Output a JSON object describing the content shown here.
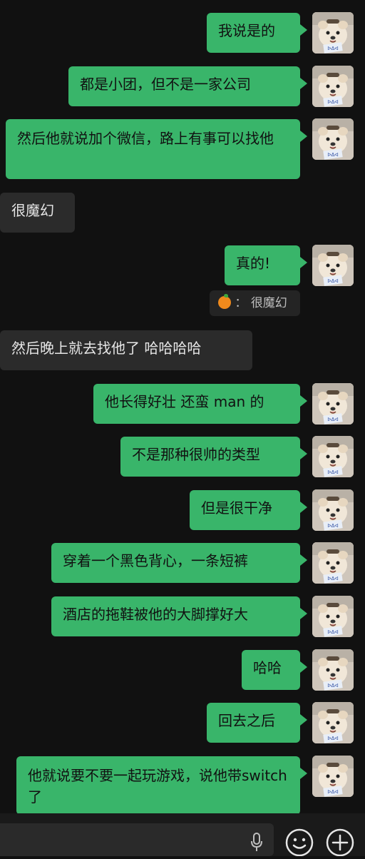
{
  "messages": [
    {
      "text": "我说是的"
    },
    {
      "text": "都是小团，但不是一家公司"
    },
    {
      "text": "然后他就说加个微信，路上有事可以找他"
    },
    {
      "text": "很魔幻"
    },
    {
      "text": "真的!"
    },
    {
      "text": "然后晚上就去找他了 哈哈哈哈"
    },
    {
      "text": "他长得好壮 还蛮 man 的"
    },
    {
      "text": "不是那种很帅的类型"
    },
    {
      "text": "但是很干净"
    },
    {
      "text": "穿着一个黑色背心，一条短裤"
    },
    {
      "text": "酒店的拖鞋被他的大脚撑好大"
    },
    {
      "text": "哈哈"
    },
    {
      "text": "回去之后"
    },
    {
      "text": "他就说要不要一起玩游戏，说他带switch 了"
    }
  ],
  "quote": {
    "separator": "：",
    "text": "很魔幻"
  },
  "icons": {
    "voice": "microphone-icon",
    "emoji": "emoji-icon",
    "add": "plus-icon",
    "quote_avatar": "orange-emoji-icon"
  },
  "colors": {
    "outgoing_bubble": "#39b56a",
    "incoming_bubble": "#2b2b2b",
    "background": "#111111"
  }
}
